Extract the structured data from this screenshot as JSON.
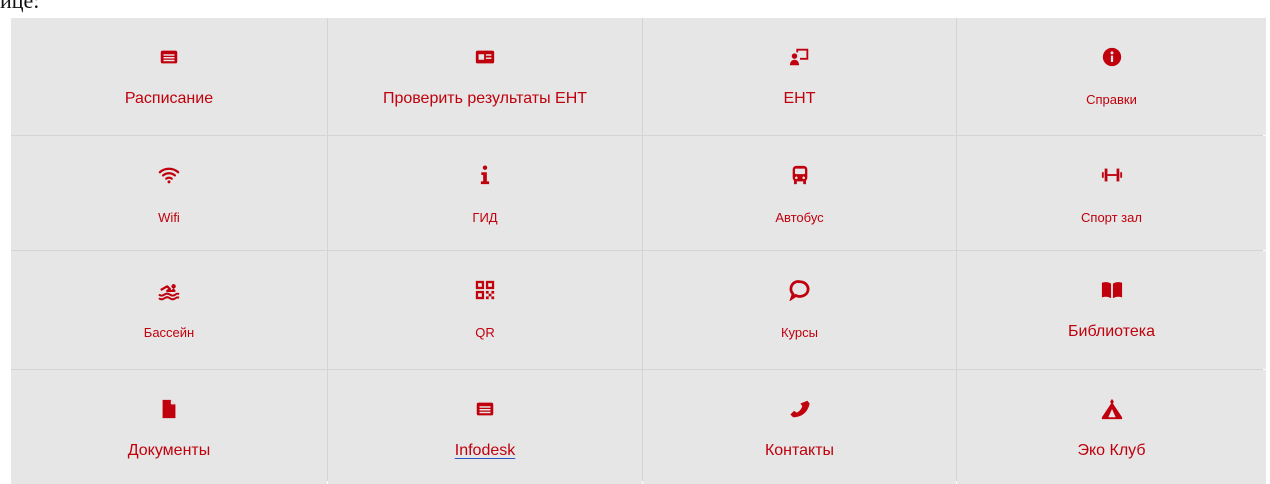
{
  "page": {
    "top_text": "ице:"
  },
  "accent_color": "#c0000c",
  "tiles": [
    {
      "label": "Расписание",
      "icon": "schedule-card-icon"
    },
    {
      "label": "Проверить результаты ЕНТ",
      "icon": "id-card-icon"
    },
    {
      "label": "ЕНТ",
      "icon": "presentation-teacher-icon"
    },
    {
      "label": "Справки",
      "icon": "info-circle-icon"
    },
    {
      "label": "Wifi",
      "icon": "wifi-icon"
    },
    {
      "label": "ГИД",
      "icon": "info-i-icon"
    },
    {
      "label": "Автобус",
      "icon": "bus-icon"
    },
    {
      "label": "Спорт зал",
      "icon": "dumbbell-icon"
    },
    {
      "label": "Бассейн",
      "icon": "swimmer-icon"
    },
    {
      "label": "QR",
      "icon": "qr-code-icon"
    },
    {
      "label": "Курсы",
      "icon": "speech-bubble-icon"
    },
    {
      "label": "Библиотека",
      "icon": "book-icon"
    },
    {
      "label": "Документы",
      "icon": "document-icon"
    },
    {
      "label": "Infodesk",
      "icon": "list-card-icon"
    },
    {
      "label": "Контакты",
      "icon": "phone-icon"
    },
    {
      "label": "Эко Клуб",
      "icon": "tent-icon"
    }
  ]
}
